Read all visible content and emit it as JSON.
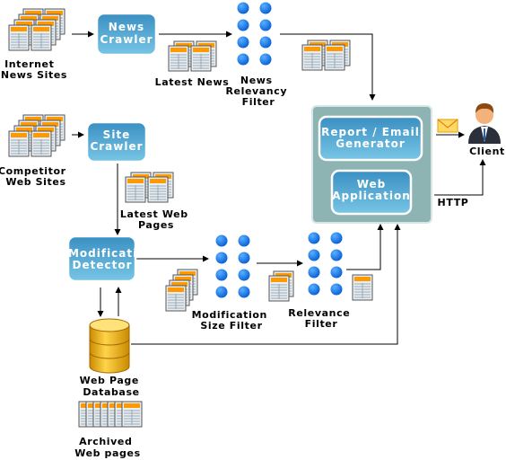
{
  "colors": {
    "box_fill_top": "#3a95c6",
    "box_fill_bottom": "#74c3e4",
    "panel": "#8db4b2",
    "dot": "#1f7fe8",
    "doc_header": "#ff9900",
    "db": "#f0b400"
  },
  "sources": {
    "internet": [
      "Internet",
      "News Sites"
    ],
    "competitor": [
      "Competitor",
      "Web Sites"
    ]
  },
  "processes": {
    "news_crawler": [
      "News",
      "Crawler"
    ],
    "site_crawler": [
      "Site",
      "Crawler"
    ],
    "modification_detector": [
      "Modification",
      "Detector"
    ],
    "report_generator": [
      "Report / Email",
      "Generator"
    ],
    "web_application": [
      "Web",
      "Application"
    ]
  },
  "labels": {
    "latest_news": "Latest News",
    "news_filter": [
      "News",
      "Relevancy",
      "Filter"
    ],
    "latest_web_pages": [
      "Latest Web",
      "Pages"
    ],
    "mod_size_filter": [
      "Modification",
      "Size Filter"
    ],
    "relevance_filter": [
      "Relevance",
      "Filter"
    ],
    "database": [
      "Web Page",
      "Database"
    ],
    "archived": [
      "Archived",
      "Web pages"
    ],
    "client": "Client",
    "http": "HTTP"
  },
  "icons": [
    "document-stack-icon",
    "filter-dots-icon",
    "database-icon",
    "envelope-icon",
    "user-icon"
  ]
}
